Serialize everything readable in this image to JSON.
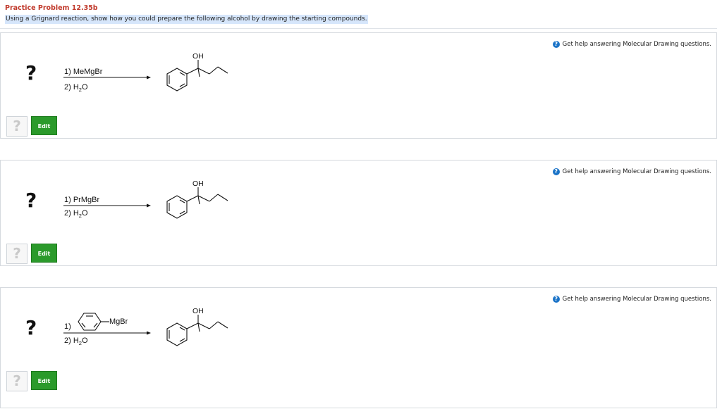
{
  "header": {
    "title": "Practice Problem 12.35b",
    "instruction": "Using a Grignard reaction, show how you could prepare the following alcohol by drawing the starting compounds."
  },
  "colors": {
    "title": "#c0392b",
    "edit_button": "#2b9a2b",
    "help_icon": "#1a73c7",
    "highlight": "#d6e6fb"
  },
  "problems": [
    {
      "help_text": "Get help answering Molecular Drawing questions.",
      "unknown": "?",
      "reagent1": "1) MeMgBr",
      "reagent2_prefix": "2) H",
      "reagent2_sub": "2",
      "reagent2_suffix": "O",
      "product_label": "OH",
      "answer_placeholder": "?",
      "edit_label": "Edit"
    },
    {
      "help_text": "Get help answering Molecular Drawing questions.",
      "unknown": "?",
      "reagent1": "1) PrMgBr",
      "reagent2_prefix": "2) H",
      "reagent2_sub": "2",
      "reagent2_suffix": "O",
      "product_label": "OH",
      "answer_placeholder": "?",
      "edit_label": "Edit"
    },
    {
      "help_text": "Get help answering Molecular Drawing questions.",
      "unknown": "?",
      "reagent1": "1)",
      "reagent1_group": "MgBr",
      "reagent2_prefix": "2) H",
      "reagent2_sub": "2",
      "reagent2_suffix": "O",
      "product_label": "OH",
      "answer_placeholder": "?",
      "edit_label": "Edit"
    }
  ]
}
